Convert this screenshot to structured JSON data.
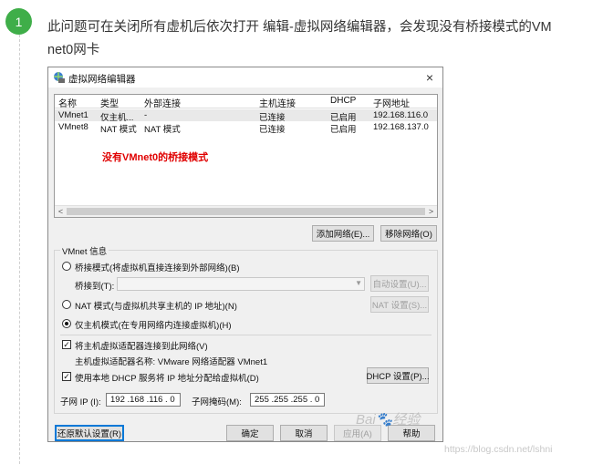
{
  "step": {
    "number": "1",
    "text": "此问题可在关闭所有虚机后依次打开 编辑-虚拟网络编辑器，会发现没有桥接模式的VMnet0网卡"
  },
  "dialog": {
    "title": "虚拟网络编辑器",
    "close_glyph": "×",
    "table": {
      "columns": [
        "名称",
        "类型",
        "外部连接",
        "主机连接",
        "DHCP",
        "子网地址"
      ],
      "rows": [
        [
          "VMnet1",
          "仅主机...",
          "-",
          "已连接",
          "已启用",
          "192.168.116.0"
        ],
        [
          "VMnet8",
          "NAT 模式",
          "NAT 模式",
          "已连接",
          "已启用",
          "192.168.137.0"
        ]
      ]
    },
    "annotation": "没有VMnet0的桥接模式",
    "scroll_left": "<",
    "scroll_right": ">",
    "add_network": "添加网络(E)...",
    "remove_network": "移除网络(O)",
    "vmnet_info": {
      "group_title": "VMnet 信息",
      "bridged_label": "桥接模式(将虚拟机直接连接到外部网络)(B)",
      "bridged_to_label": "桥接到(T):",
      "auto_settings": "自动设置(U)...",
      "nat_label": "NAT 模式(与虚拟机共享主机的 IP 地址)(N)",
      "nat_settings": "NAT 设置(S)...",
      "hostonly_label": "仅主机模式(在专用网络内连接虚拟机)(H)",
      "connect_adapter_label": "将主机虚拟适配器连接到此网络(V)",
      "adapter_name_label": "主机虚拟适配器名称: VMware 网络适配器 VMnet1",
      "dhcp_label": "使用本地 DHCP 服务将 IP 地址分配给虚拟机(D)",
      "dhcp_settings": "DHCP 设置(P)...",
      "subnet_ip_label": "子网 IP (I):",
      "subnet_ip_value": "192 .168 .116 . 0",
      "subnet_mask_label": "子网掩码(M):",
      "subnet_mask_value": "255 .255 .255 . 0"
    },
    "buttons": {
      "restore_defaults": "还原默认设置(R)",
      "ok": "确定",
      "cancel": "取消",
      "apply": "应用(A)",
      "help": "帮助"
    }
  },
  "watermarks": {
    "baidu": "Bai🐾经验",
    "url": "https://blog.csdn.net/lshni"
  }
}
